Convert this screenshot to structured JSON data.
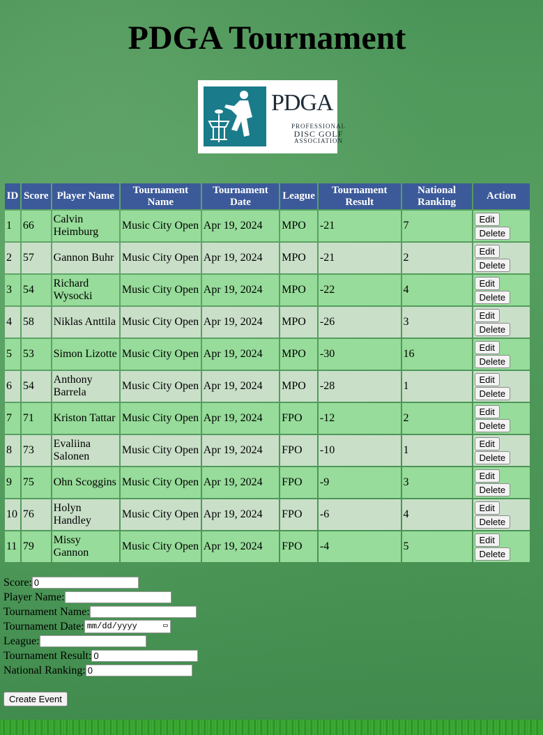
{
  "page": {
    "title": "PDGA Tournament"
  },
  "logo": {
    "word": "PDGA",
    "sub": [
      "PROFESSIONAL",
      "DISC GOLF",
      "ASSOCIATION"
    ]
  },
  "table": {
    "headers": [
      "ID",
      "Score",
      "Player Name",
      "Tournament Name",
      "Tournament Date",
      "League",
      "Tournament Result",
      "National Ranking",
      "Action"
    ],
    "edit_label": "Edit",
    "delete_label": "Delete",
    "rows": [
      {
        "id": "1",
        "score": "66",
        "player": "Calvin Heimburg",
        "tournament": "Music City Open",
        "date": "Apr 19, 2024",
        "league": "MPO",
        "result": "-21",
        "ranking": "7"
      },
      {
        "id": "2",
        "score": "57",
        "player": "Gannon Buhr",
        "tournament": "Music City Open",
        "date": "Apr 19, 2024",
        "league": "MPO",
        "result": "-21",
        "ranking": "2"
      },
      {
        "id": "3",
        "score": "54",
        "player": "Richard Wysocki",
        "tournament": "Music City Open",
        "date": "Apr 19, 2024",
        "league": "MPO",
        "result": "-22",
        "ranking": "4"
      },
      {
        "id": "4",
        "score": "58",
        "player": "Niklas Anttila",
        "tournament": "Music City Open",
        "date": "Apr 19, 2024",
        "league": "MPO",
        "result": "-26",
        "ranking": "3"
      },
      {
        "id": "5",
        "score": "53",
        "player": "Simon Lizotte",
        "tournament": "Music City Open",
        "date": "Apr 19, 2024",
        "league": "MPO",
        "result": "-30",
        "ranking": "16"
      },
      {
        "id": "6",
        "score": "54",
        "player": "Anthony Barrela",
        "tournament": "Music City Open",
        "date": "Apr 19, 2024",
        "league": "MPO",
        "result": "-28",
        "ranking": "1"
      },
      {
        "id": "7",
        "score": "71",
        "player": "Kriston Tattar",
        "tournament": "Music City Open",
        "date": "Apr 19, 2024",
        "league": "FPO",
        "result": "-12",
        "ranking": "2"
      },
      {
        "id": "8",
        "score": "73",
        "player": "Evaliina Salonen",
        "tournament": "Music City Open",
        "date": "Apr 19, 2024",
        "league": "FPO",
        "result": "-10",
        "ranking": "1"
      },
      {
        "id": "9",
        "score": "75",
        "player": "Ohn Scoggins",
        "tournament": "Music City Open",
        "date": "Apr 19, 2024",
        "league": "FPO",
        "result": "-9",
        "ranking": "3"
      },
      {
        "id": "10",
        "score": "76",
        "player": "Holyn Handley",
        "tournament": "Music City Open",
        "date": "Apr 19, 2024",
        "league": "FPO",
        "result": "-6",
        "ranking": "4"
      },
      {
        "id": "11",
        "score": "79",
        "player": "Missy Gannon",
        "tournament": "Music City Open",
        "date": "Apr 19, 2024",
        "league": "FPO",
        "result": "-4",
        "ranking": "5"
      }
    ]
  },
  "form": {
    "score": {
      "label": "Score:",
      "value": "0"
    },
    "player_name": {
      "label": "Player Name:",
      "value": ""
    },
    "tournament_name": {
      "label": "Tournament Name:",
      "value": ""
    },
    "tournament_date": {
      "label": "Tournament Date:",
      "placeholder": "mm/dd/yyyy"
    },
    "league": {
      "label": "League:",
      "value": ""
    },
    "tournament_result": {
      "label": "Tournament Result:",
      "value": "0"
    },
    "national_ranking": {
      "label": "National Ranking:",
      "value": "0"
    },
    "create_label": "Create Event"
  },
  "colors": {
    "header_bg": "#3c5a99",
    "row_odd": "#97dc9a",
    "row_even": "#c9dfc8"
  }
}
